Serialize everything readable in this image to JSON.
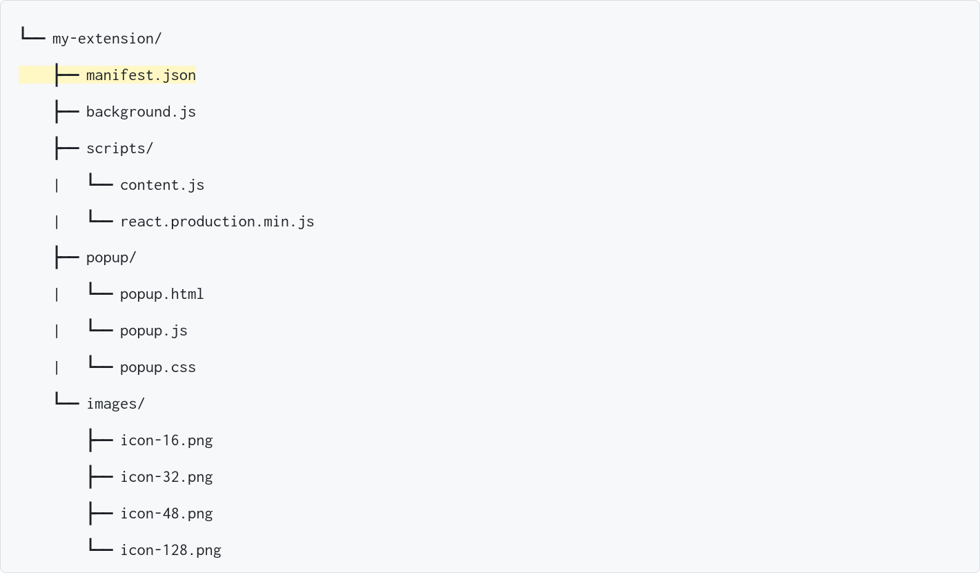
{
  "tree": {
    "lines": [
      {
        "prefix": "└── ",
        "name": "my-extension/",
        "highlighted": false
      },
      {
        "prefix": "    ├── ",
        "name": "manifest.json",
        "highlighted": true
      },
      {
        "prefix": "    ├── ",
        "name": "background.js",
        "highlighted": false
      },
      {
        "prefix": "    ├── ",
        "name": "scripts/",
        "highlighted": false
      },
      {
        "prefix": "    |   └── ",
        "name": "content.js",
        "highlighted": false
      },
      {
        "prefix": "    |   └── ",
        "name": "react.production.min.js",
        "highlighted": false
      },
      {
        "prefix": "    ├── ",
        "name": "popup/",
        "highlighted": false
      },
      {
        "prefix": "    |   └── ",
        "name": "popup.html",
        "highlighted": false
      },
      {
        "prefix": "    |   └── ",
        "name": "popup.js",
        "highlighted": false
      },
      {
        "prefix": "    |   └── ",
        "name": "popup.css",
        "highlighted": false
      },
      {
        "prefix": "    └── ",
        "name": "images/",
        "highlighted": false
      },
      {
        "prefix": "        ├── ",
        "name": "icon-16.png",
        "highlighted": false
      },
      {
        "prefix": "        ├── ",
        "name": "icon-32.png",
        "highlighted": false
      },
      {
        "prefix": "        ├── ",
        "name": "icon-48.png",
        "highlighted": false
      },
      {
        "prefix": "        └── ",
        "name": "icon-128.png",
        "highlighted": false
      }
    ]
  }
}
